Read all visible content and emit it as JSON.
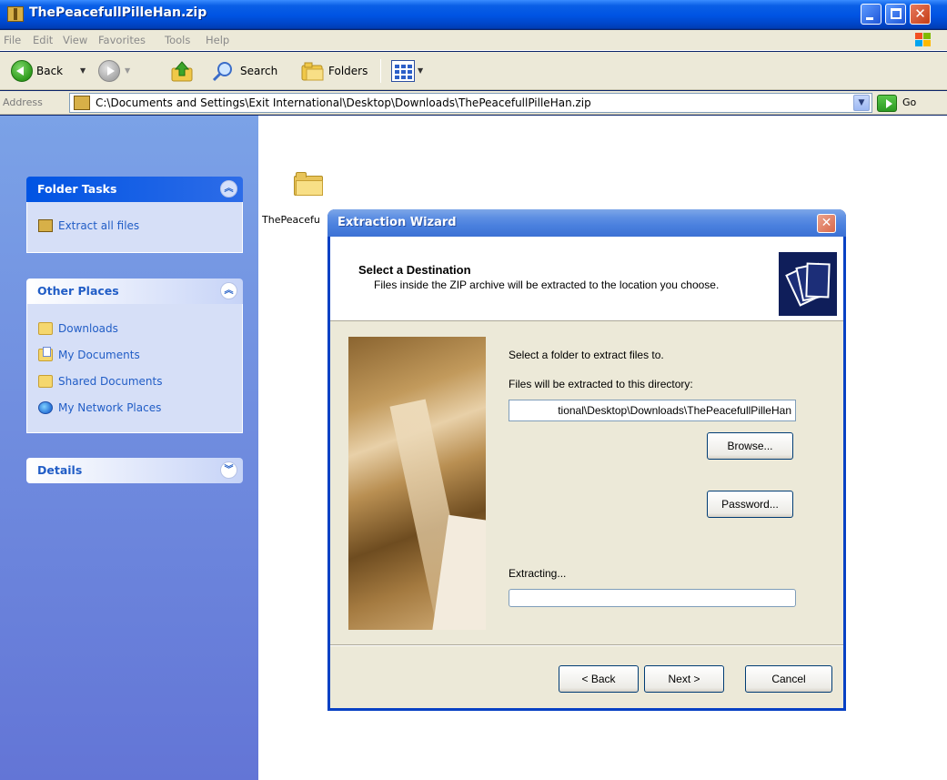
{
  "window": {
    "title": "ThePeacefullPilleHan.zip",
    "menu": [
      "File",
      "Edit",
      "View",
      "Favorites",
      "Tools",
      "Help"
    ]
  },
  "toolbar": {
    "back_label": "Back",
    "search_label": "Search",
    "folders_label": "Folders"
  },
  "address": {
    "label": "Address",
    "value": "C:\\Documents and Settings\\Exit International\\Desktop\\Downloads\\ThePeacefullPilleHan.zip",
    "go_label": "Go"
  },
  "taskpane": {
    "folder_tasks": {
      "title": "Folder Tasks",
      "items": [
        {
          "label": "Extract all files",
          "icon": "zip-extract-icon"
        }
      ]
    },
    "other_places": {
      "title": "Other Places",
      "items": [
        {
          "label": "Downloads",
          "icon": "folder-icon"
        },
        {
          "label": "My Documents",
          "icon": "documents-icon"
        },
        {
          "label": "Shared Documents",
          "icon": "folder-icon"
        },
        {
          "label": "My Network Places",
          "icon": "network-icon"
        }
      ]
    },
    "details": {
      "title": "Details"
    }
  },
  "content": {
    "folder_label": "ThePeacefu"
  },
  "dialog": {
    "title": "Extraction Wizard",
    "heading": "Select a Destination",
    "subheading": "Files inside the ZIP archive will be extracted to the location you choose.",
    "select_prompt": "Select a folder to extract files to.",
    "directory_label": "Files will be extracted to this directory:",
    "path_value": "tional\\Desktop\\Downloads\\ThePeacefullPilleHan",
    "browse_label": "Browse...",
    "password_label": "Password...",
    "extracting_label": "Extracting...",
    "progress_fraction": 0,
    "back_label": "< Back",
    "next_label": "Next >",
    "cancel_label": "Cancel"
  },
  "colors": {
    "title_bar_blue": "#0054E3",
    "taskpane_blue": "#6375D6",
    "panel_link": "#215DC6",
    "dialog_face": "#ECE9D8",
    "close_red": "#C43D16"
  }
}
